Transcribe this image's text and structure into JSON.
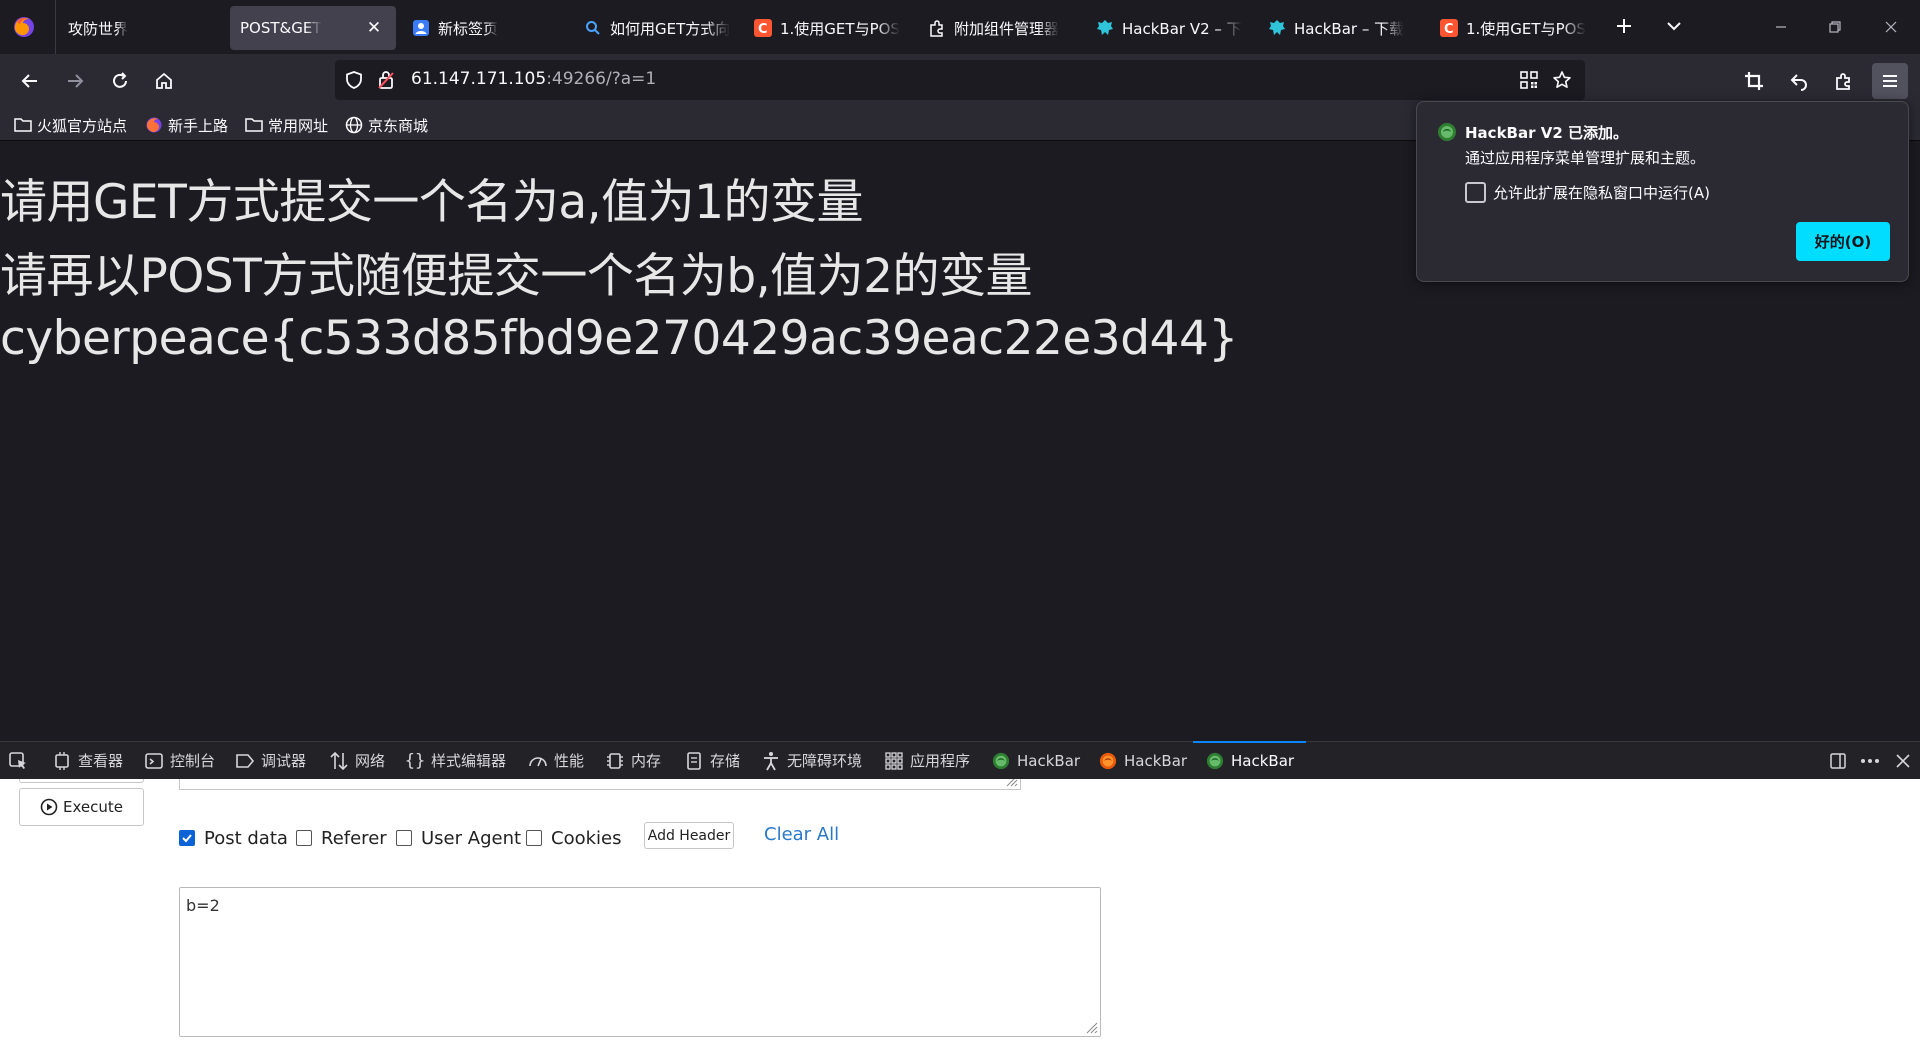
{
  "tabs": [
    {
      "label": "攻防世界",
      "icon": "none",
      "active": false
    },
    {
      "label": "POST&GET",
      "icon": "none",
      "active": true
    },
    {
      "label": "新标签页",
      "icon": "firefox-account-icon",
      "active": false
    },
    {
      "label": "如何用GET方式向",
      "icon": "search-icon",
      "active": false
    },
    {
      "label": "1.使用GET与POS",
      "icon": "csdn-icon",
      "active": false
    },
    {
      "label": "附加组件管理器",
      "icon": "puzzle-icon",
      "active": false
    },
    {
      "label": "HackBar V2 – 下",
      "icon": "hackbar-icon",
      "active": false
    },
    {
      "label": "HackBar – 下载",
      "icon": "hackbar-icon",
      "active": false
    },
    {
      "label": "1.使用GET与POS",
      "icon": "csdn-icon",
      "active": false
    }
  ],
  "url": {
    "host": "61.147.171.105",
    "rest": ":49266/?a=1"
  },
  "bookmarks": [
    {
      "label": "火狐官方站点",
      "icon": "folder-icon"
    },
    {
      "label": "新手上路",
      "icon": "firefox-icon"
    },
    {
      "label": "常用网址",
      "icon": "folder-icon"
    },
    {
      "label": "京东商城",
      "icon": "globe-icon"
    }
  ],
  "page": {
    "line1": "请用GET方式提交一个名为a,值为1的变量",
    "line2": "请再以POST方式随便提交一个名为b,值为2的变量",
    "flag": "cyberpeace{c533d85fbd9e270429ac39eac22e3d44}"
  },
  "popup": {
    "title": "HackBar V2 已添加。",
    "description": "通过应用程序菜单管理扩展和主题。",
    "checkbox_label": "允许此扩展在隐私窗口中运行(A)",
    "checkbox_checked": false,
    "ok_label": "好的(O)"
  },
  "devtools": {
    "tabs": [
      {
        "label": "查看器",
        "icon": "inspector-icon"
      },
      {
        "label": "控制台",
        "icon": "console-icon"
      },
      {
        "label": "调试器",
        "icon": "debugger-icon"
      },
      {
        "label": "网络",
        "icon": "network-icon"
      },
      {
        "label": "样式编辑器",
        "icon": "style-editor-icon"
      },
      {
        "label": "性能",
        "icon": "performance-icon"
      },
      {
        "label": "内存",
        "icon": "memory-icon"
      },
      {
        "label": "存储",
        "icon": "storage-icon"
      },
      {
        "label": "无障碍环境",
        "icon": "accessibility-icon"
      },
      {
        "label": "应用程序",
        "icon": "application-icon"
      },
      {
        "label": "HackBar",
        "icon": "hackbar-green-icon"
      },
      {
        "label": "HackBar",
        "icon": "hackbar-orange-icon"
      },
      {
        "label": "HackBar",
        "icon": "hackbar-green-icon",
        "active": true
      }
    ]
  },
  "hackbar": {
    "execute_label": "Execute",
    "options": [
      {
        "label": "Post data",
        "checked": true
      },
      {
        "label": "Referer",
        "checked": false
      },
      {
        "label": "User Agent",
        "checked": false
      },
      {
        "label": "Cookies",
        "checked": false
      }
    ],
    "add_header_label": "Add Header",
    "clear_all_label": "Clear All",
    "post_data_value": "b=2"
  },
  "colors": {
    "accent": "#00ddff",
    "devtools_active": "#0a84ff",
    "checkbox_checked": "#0b63d6",
    "link": "#2a79c8"
  }
}
